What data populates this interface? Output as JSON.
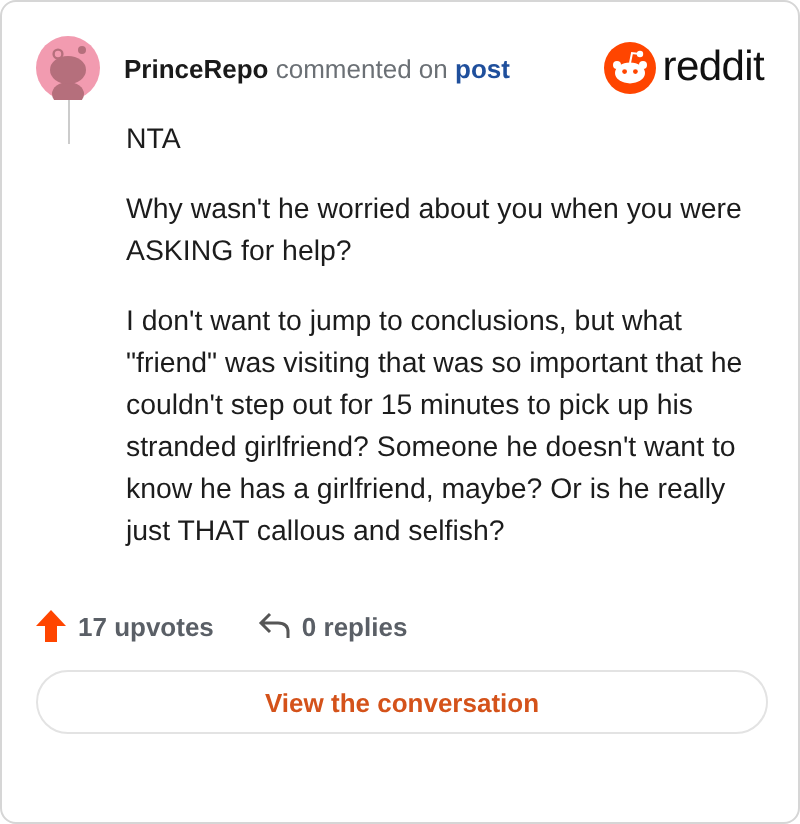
{
  "comment": {
    "author": "PrinceRepo",
    "action": "commented on",
    "link": "post"
  },
  "brand": "reddit",
  "paragraphs": [
    "NTA",
    "Why wasn't he worried about you when you were ASKING for help?",
    "I don't want to jump to conclusions, but what \"friend\" was visiting that was so important that he couldn't step out for 15 minutes to pick up his stranded girlfriend? Someone he doesn't want to know he has a girlfriend, maybe? Or is he really just THAT callous and selfish?"
  ],
  "upvotes": "17 upvotes",
  "replies": "0 replies",
  "button": "View the conversation"
}
